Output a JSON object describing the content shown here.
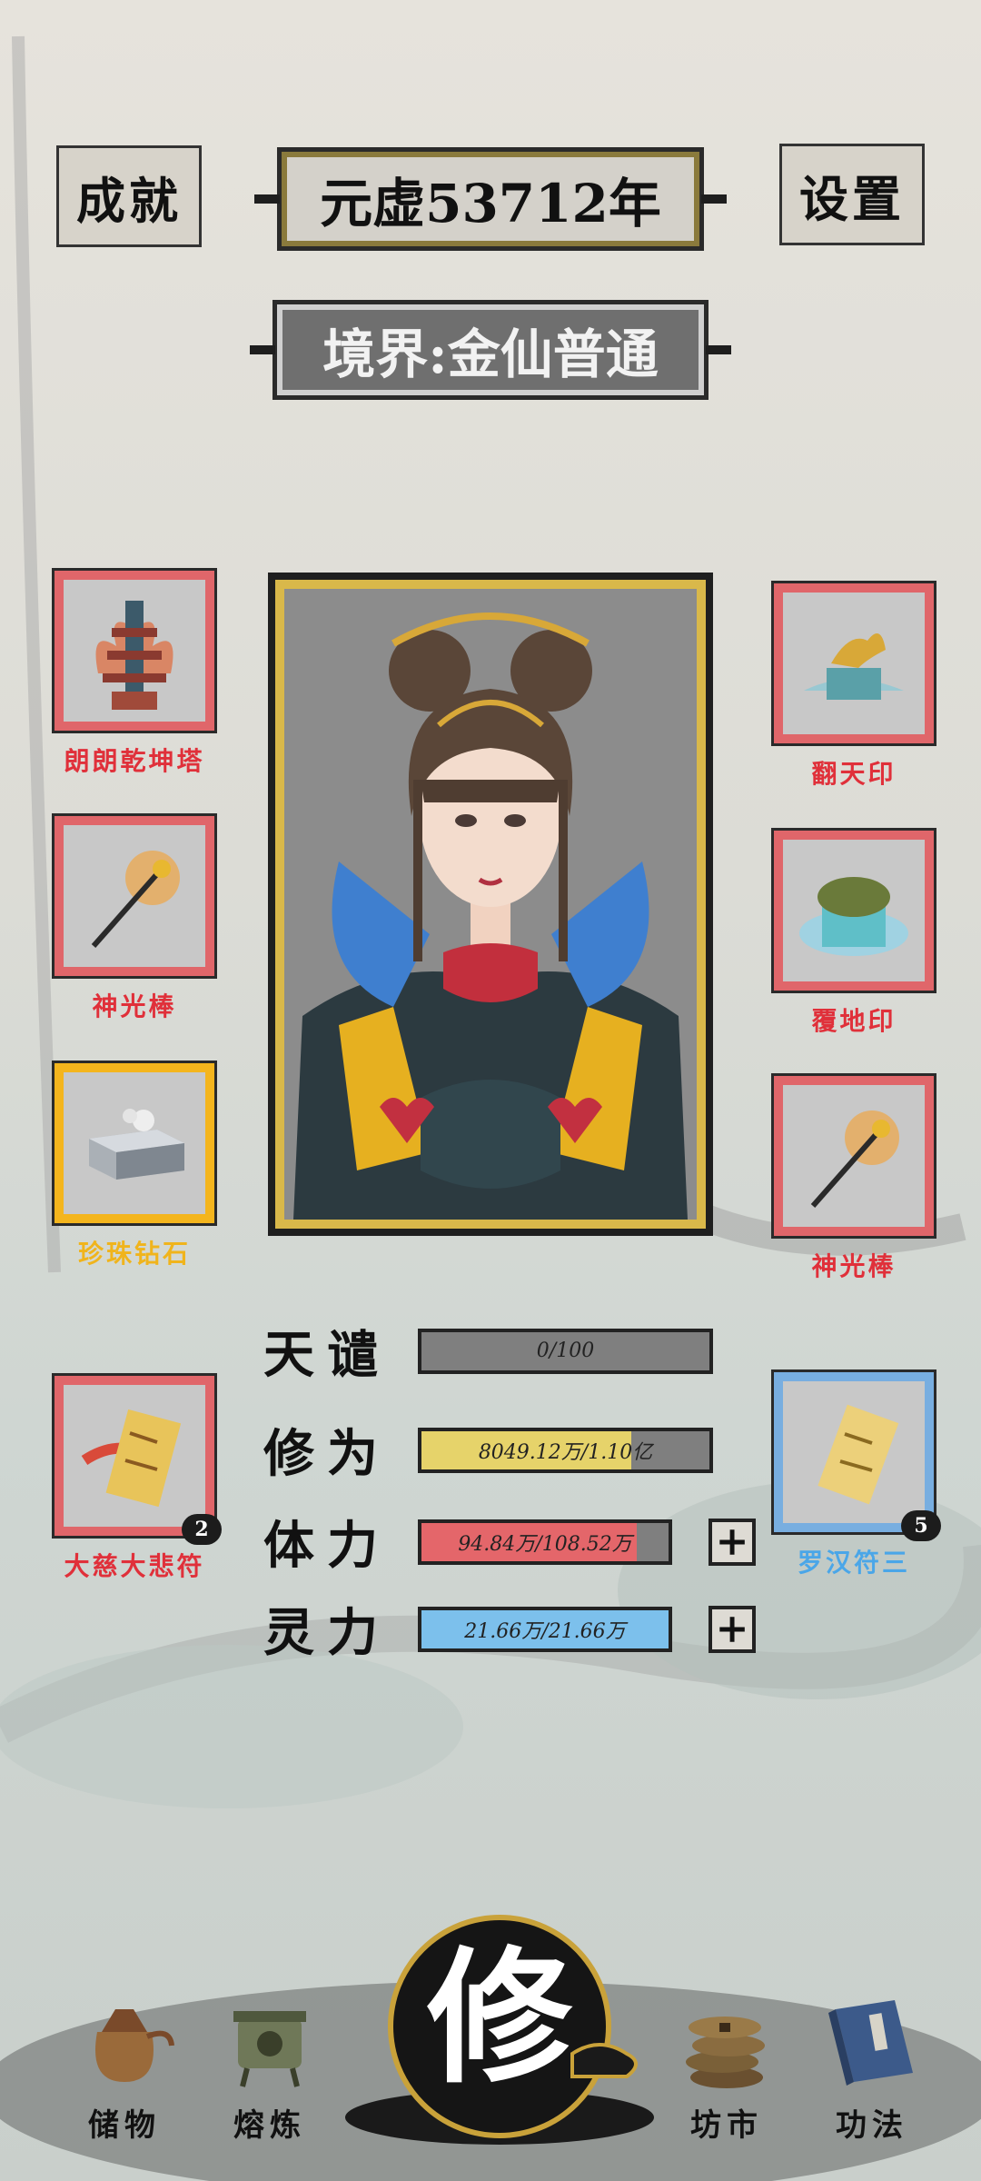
{
  "header": {
    "achievements_label": "成就",
    "year_label": "元虚53712年",
    "settings_label": "设置",
    "realm_label": "境界:金仙普通"
  },
  "left_items": [
    {
      "name": "朗朗乾坤塔",
      "frame": "red"
    },
    {
      "name": "神光棒",
      "frame": "red"
    },
    {
      "name": "珍珠钻石",
      "frame": "gold"
    },
    {
      "name": "大慈大悲符",
      "frame": "red",
      "count": "2"
    }
  ],
  "right_items": [
    {
      "name": "翻天印",
      "frame": "red"
    },
    {
      "name": "覆地印",
      "frame": "red"
    },
    {
      "name": "神光棒",
      "frame": "red"
    },
    {
      "name": "罗汉符三",
      "frame": "blue",
      "count": "5"
    }
  ],
  "stats": [
    {
      "name": "天谴",
      "value": "0/100",
      "fill": 0.0,
      "color": "#8a8a8a"
    },
    {
      "name": "修为",
      "value": "8049.12万/1.10亿",
      "fill": 0.73,
      "color": "#e6d36a"
    },
    {
      "name": "体力",
      "value": "94.84万/108.52万",
      "fill": 0.87,
      "color": "#e4666a"
    },
    {
      "name": "灵力",
      "value": "21.66万/21.66万",
      "fill": 1.0,
      "color": "#7cc0ec"
    }
  ],
  "bottom_nav": {
    "storage": "储物",
    "smelt": "熔炼",
    "cultivate": "修",
    "market": "坊市",
    "skills": "功法"
  },
  "colors": {
    "red_label": "#e0303a",
    "gold_label": "#f0b41c",
    "blue_label": "#4aa6e8"
  }
}
